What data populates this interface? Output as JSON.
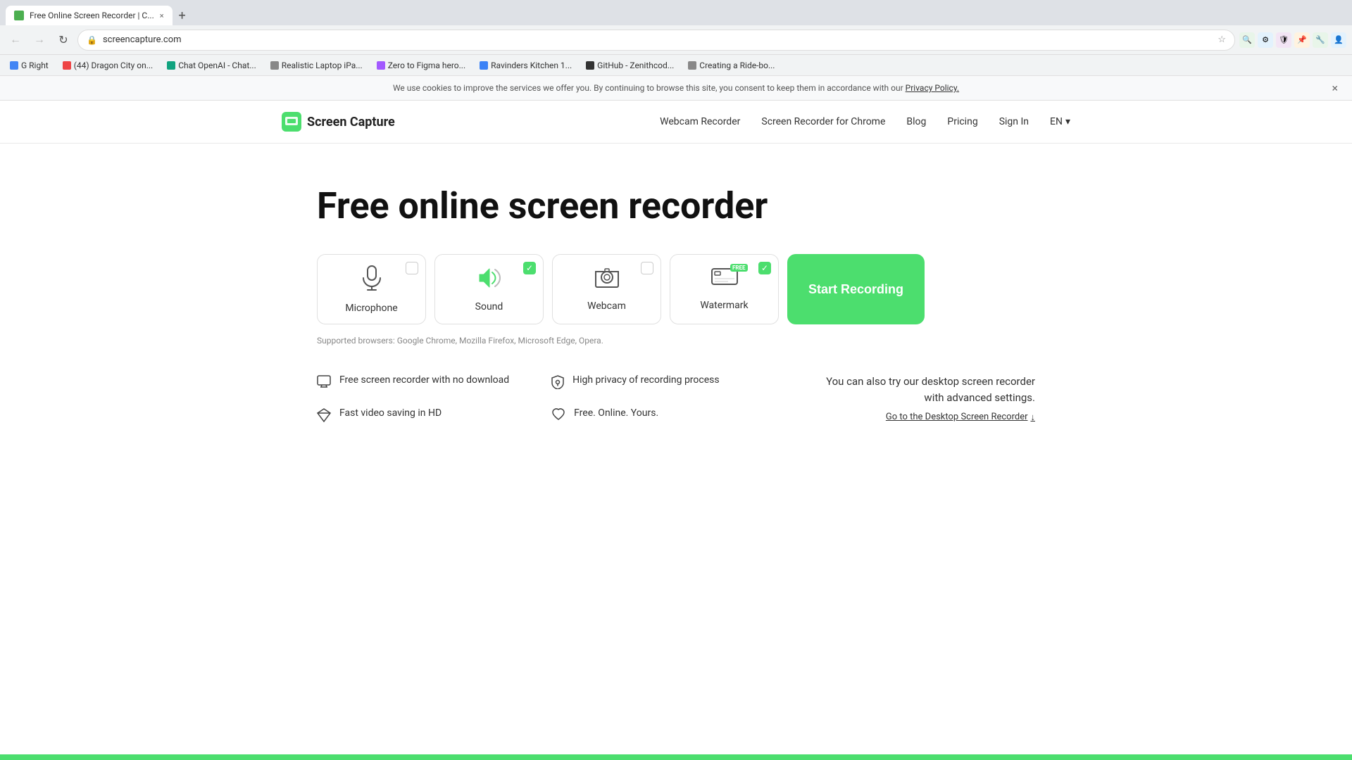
{
  "browser": {
    "tab_title": "Free Online Screen Recorder | C...",
    "tab_favicon_color": "#4caf50",
    "url": "screencapture.com",
    "new_tab_label": "+",
    "back_disabled": false,
    "forward_disabled": true,
    "bookmarks": [
      {
        "label": "G Right",
        "color": "#4285f4"
      },
      {
        "label": "(44) Dragon City on...",
        "color": "#e44"
      },
      {
        "label": "Chat OpenAI - Chat...",
        "color": "#10a37f"
      },
      {
        "label": "Realistic Laptop iPa...",
        "color": "#888"
      },
      {
        "label": "Zero to Figma hero...",
        "color": "#a259ff"
      },
      {
        "label": "Ravinders Kitchen 1...",
        "color": "#3b82f6"
      },
      {
        "label": "GitHub - Zenithcod...",
        "color": "#333"
      },
      {
        "label": "Creating a Ride-bo...",
        "color": "#888"
      }
    ]
  },
  "cookie_banner": {
    "text": "We use cookies to improve the services we offer you. By continuing to browse this site, you consent to keep them in accordance with our",
    "link_text": "Privacy Policy.",
    "close_label": "×"
  },
  "nav": {
    "logo_text": "Screen Capture",
    "links": [
      {
        "label": "Webcam Recorder"
      },
      {
        "label": "Screen Recorder for Chrome"
      },
      {
        "label": "Blog"
      },
      {
        "label": "Pricing"
      },
      {
        "label": "Sign In"
      }
    ],
    "lang": "EN"
  },
  "hero": {
    "title": "Free online screen recorder"
  },
  "recording_options": [
    {
      "id": "microphone",
      "label": "Microphone",
      "checked": false,
      "icon_type": "mic"
    },
    {
      "id": "sound",
      "label": "Sound",
      "checked": true,
      "icon_type": "sound"
    },
    {
      "id": "webcam",
      "label": "Webcam",
      "checked": false,
      "icon_type": "webcam"
    },
    {
      "id": "watermark",
      "label": "Watermark",
      "checked": true,
      "icon_type": "watermark",
      "badge": "FREE"
    }
  ],
  "start_button": {
    "label": "Start Recording"
  },
  "supported_browsers": {
    "text": "Supported browsers: Google Chrome, Mozilla Firefox, Microsoft Edge, Opera."
  },
  "features": [
    {
      "icon_type": "monitor",
      "text": "Free screen recorder with no download"
    },
    {
      "icon_type": "privacy",
      "text": "High privacy of recording process"
    },
    {
      "icon_type": "diamond",
      "text": "Fast video saving in HD"
    },
    {
      "icon_type": "heart",
      "text": "Free. Online. Yours."
    }
  ],
  "desktop_cta": {
    "text": "You can also try our desktop screen recorder with advanced settings.",
    "link_label": "Go to the Desktop Screen Recorder",
    "link_arrow": "↓"
  }
}
